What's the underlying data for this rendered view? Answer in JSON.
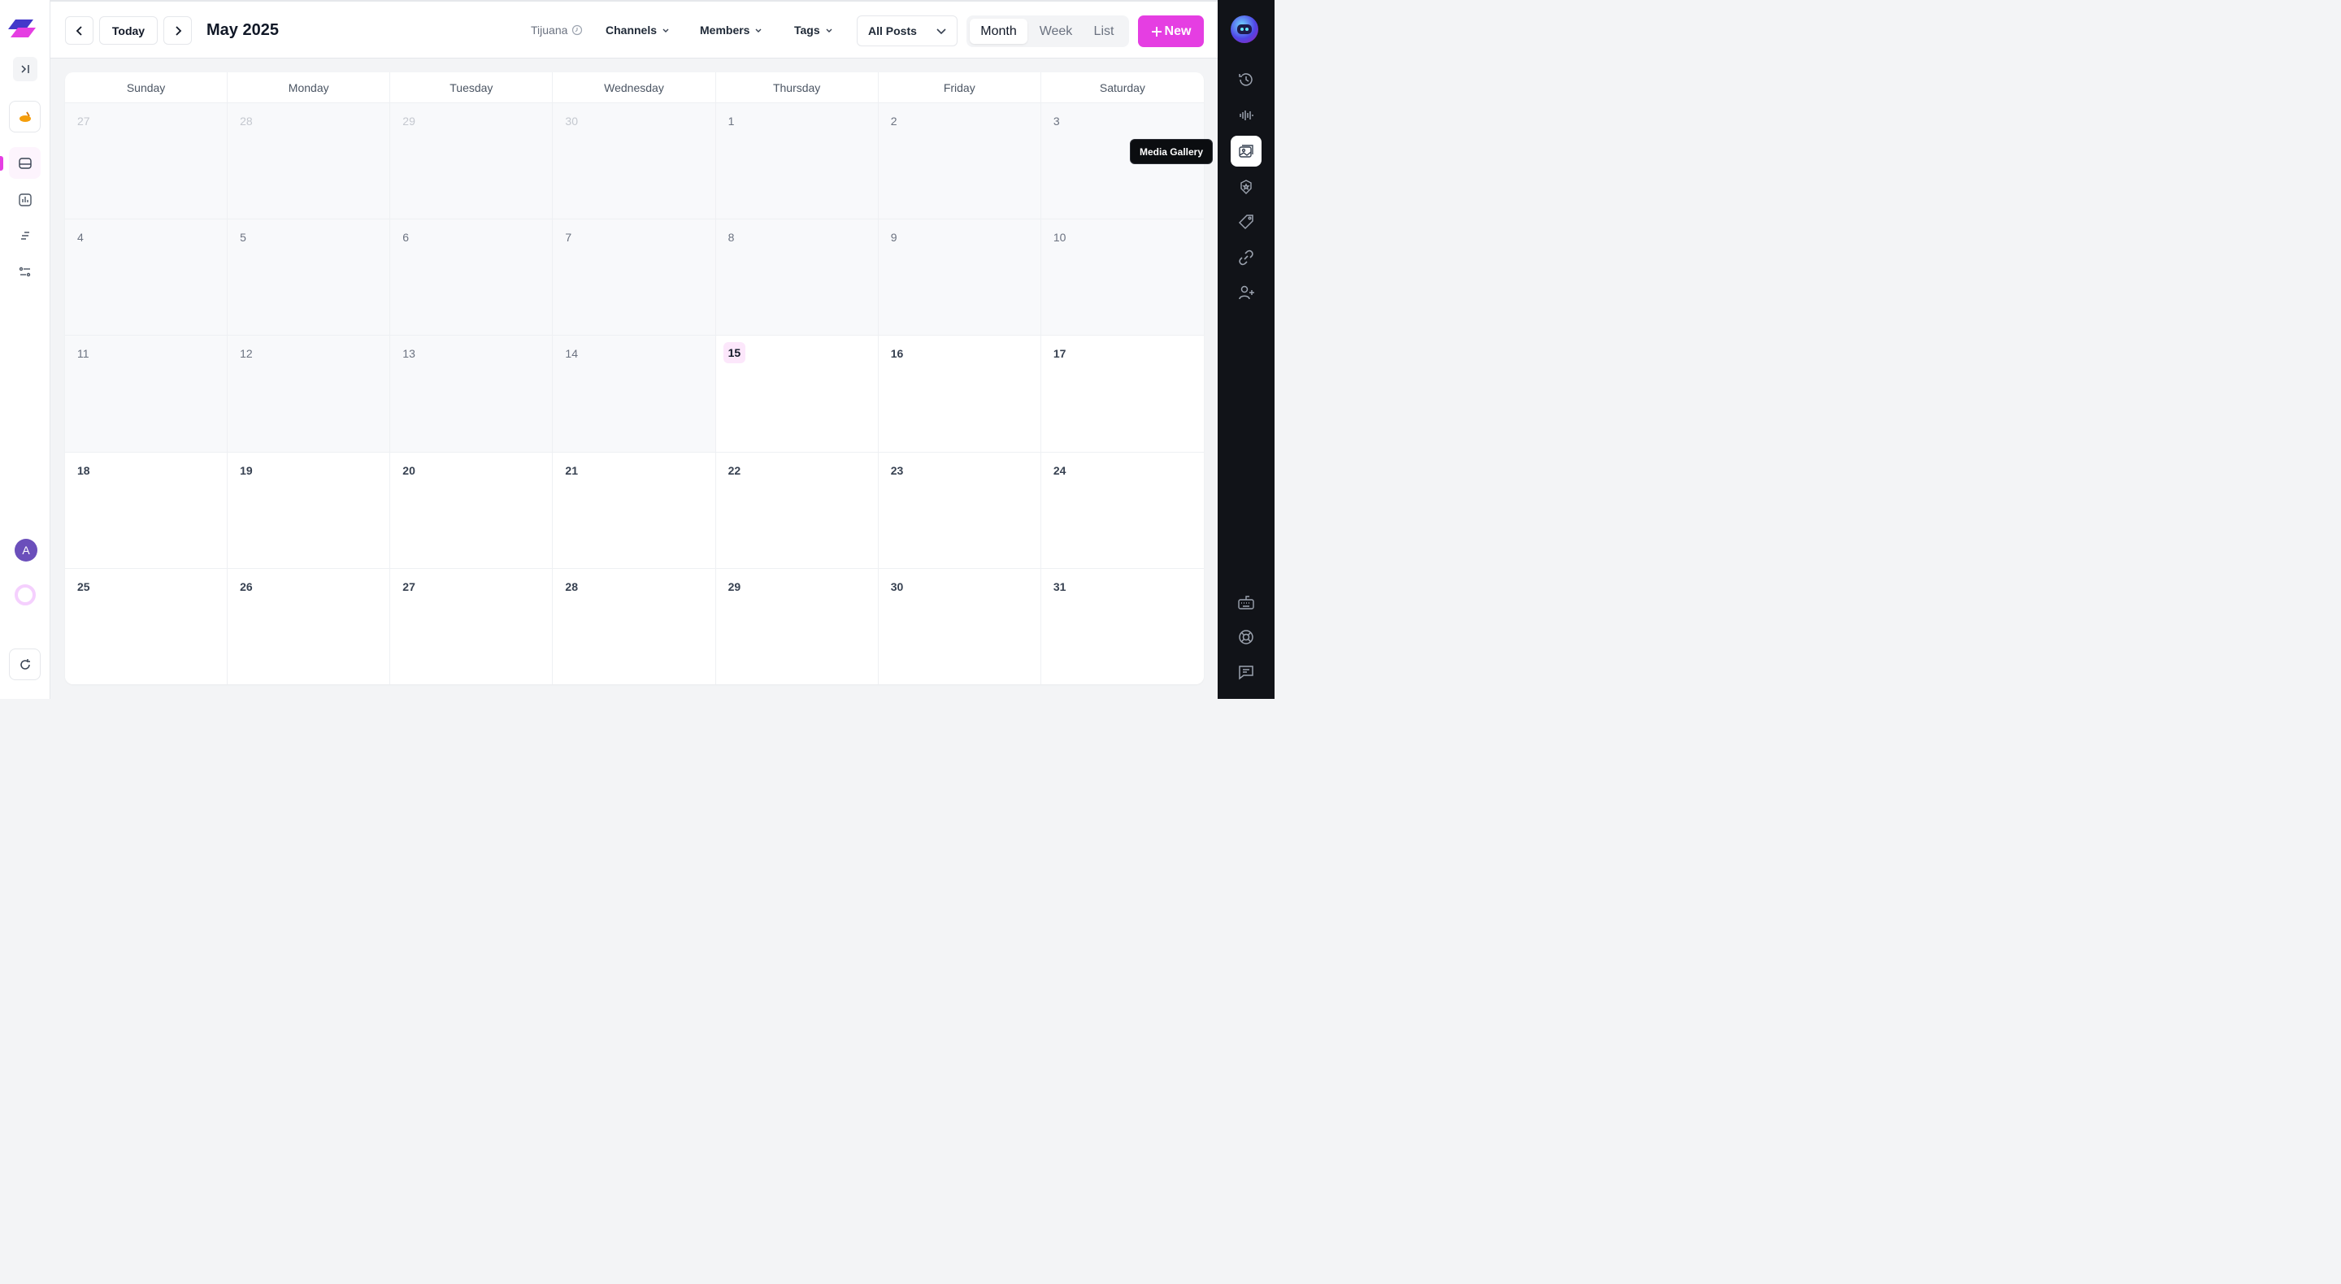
{
  "header": {
    "today_label": "Today",
    "month_title": "May 2025",
    "timezone": "Tijuana",
    "filters": {
      "channels": "Channels",
      "members": "Members",
      "tags": "Tags"
    },
    "post_filter": "All Posts",
    "views": {
      "month": "Month",
      "week": "Week",
      "list": "List",
      "selected": "Month"
    },
    "new_label": "New"
  },
  "calendar": {
    "weekdays": [
      "Sunday",
      "Monday",
      "Tuesday",
      "Wednesday",
      "Thursday",
      "Friday",
      "Saturday"
    ],
    "today": "15",
    "weeks": [
      [
        "27",
        "28",
        "29",
        "30",
        "1",
        "2",
        "3"
      ],
      [
        "4",
        "5",
        "6",
        "7",
        "8",
        "9",
        "10"
      ],
      [
        "11",
        "12",
        "13",
        "14",
        "15",
        "16",
        "17"
      ],
      [
        "18",
        "19",
        "20",
        "21",
        "22",
        "23",
        "24"
      ],
      [
        "25",
        "26",
        "27",
        "28",
        "29",
        "30",
        "31"
      ]
    ]
  },
  "user": {
    "avatar_initial": "A"
  },
  "tooltip": {
    "text": "Media Gallery"
  },
  "colors": {
    "accent": "#e53ee2",
    "sidebar_dark": "#111318"
  }
}
